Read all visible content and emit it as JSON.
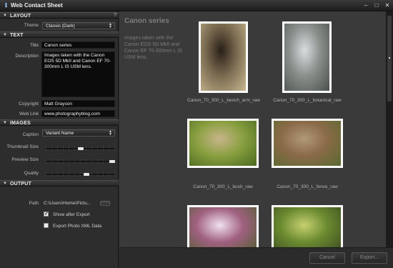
{
  "window": {
    "title": "Web Contact Sheet",
    "controls": [
      "–",
      "□",
      "✕"
    ]
  },
  "sidebar": {
    "layout": {
      "header": "LAYOUT",
      "help": "?",
      "theme_label": "Theme",
      "theme_value": "Classic (Dark)"
    },
    "text": {
      "header": "TEXT",
      "title_label": "Title",
      "title_value": "Canon series",
      "description_label": "Description",
      "description_value": "Images taken with the Canon EOS 5D MkII and Canon EF 70-300mm L IS USM lens.",
      "copyright_label": "Copyright",
      "copyright_value": "Matt Grayson",
      "weblink_label": "Web Link",
      "weblink_value": "www.photographyblog.com"
    },
    "images": {
      "header": "IMAGES",
      "caption_label": "Caption",
      "caption_value": "Variant Name",
      "thumbnail_label": "Thumbnail Size",
      "thumbnail_level": 0.5,
      "preview_label": "Preview Size",
      "preview_level": 1.0,
      "quality_label": "Quality",
      "quality_level": 0.6
    },
    "output": {
      "header": "OUTPUT",
      "path_label": "Path",
      "path_value": "C:\\Users\\Home\\Pictu...",
      "show_after_export_label": "Show after Export",
      "show_after_export": true,
      "export_xml_label": "Export Photo XML Data",
      "export_xml": false
    }
  },
  "main": {
    "title": "Canon series",
    "description": "Images taken with the Canon EOS 5D MkII and Canon EF 70-300mm L IS USM lens.",
    "photos": [
      {
        "caption": "Canon_70_300_L_bench_arm_raw",
        "colors": [
          "#2a2018",
          "#7a6a50",
          "#c9b890"
        ]
      },
      {
        "caption": "Canon_70_300_L_botanical_raw",
        "colors": [
          "#d8dde0",
          "#8a8f8c",
          "#4a4f4a"
        ]
      },
      {
        "caption": "Canon_70_300_L_bush_raw",
        "colors": [
          "#c8b48c",
          "#8aa040",
          "#4a6a20"
        ]
      },
      {
        "caption": "Canon_70_300_L_fence_raw",
        "colors": [
          "#b09878",
          "#8a6a48",
          "#5a6a30"
        ]
      },
      {
        "caption": "",
        "colors": [
          "#f0e0f0",
          "#a06080",
          "#506030"
        ]
      },
      {
        "caption": "",
        "colors": [
          "#c8d070",
          "#6a8a30",
          "#3a4a20"
        ]
      }
    ]
  },
  "footer": {
    "cancel_label": "Cancel",
    "export_label": "Export..."
  }
}
